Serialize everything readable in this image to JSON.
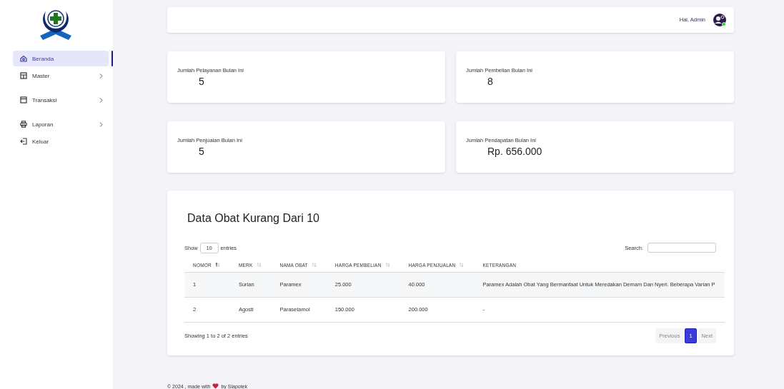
{
  "sidebar": {
    "items": [
      {
        "label": "Beranda",
        "selected": true,
        "has_submenu": false
      },
      {
        "label": "Master",
        "selected": false,
        "has_submenu": true
      },
      {
        "label": "Transaksi",
        "selected": false,
        "has_submenu": true
      },
      {
        "label": "Laporan",
        "selected": false,
        "has_submenu": true
      },
      {
        "label": "Keluar",
        "selected": false,
        "has_submenu": false
      }
    ]
  },
  "topbar": {
    "greeting": "Hai, Admin",
    "online": true
  },
  "stats": [
    {
      "label": "Jumlah Pelayanan Bulan Ini",
      "value": "5"
    },
    {
      "label": "Jumlah Pembelian Bulan Ini",
      "value": "8"
    },
    {
      "label": "Jumlah Penjualan Bulan Ini",
      "value": "5"
    },
    {
      "label": "Jumlah Pendapatan Bulan Ini",
      "value": "Rp. 656.000"
    }
  ],
  "table_card": {
    "title": "Data Obat Kurang Dari 10",
    "show_label": "Show",
    "page_size": "10",
    "entries_label": "entries",
    "search_label": "Search:",
    "columns": [
      {
        "label": "NOMOR",
        "sortable": true,
        "sorted": true
      },
      {
        "label": "MERK",
        "sortable": true,
        "sorted": false
      },
      {
        "label": "NAMA OBAT",
        "sortable": true,
        "sorted": false
      },
      {
        "label": "HARGA PEMBELIAN",
        "sortable": true,
        "sorted": false
      },
      {
        "label": "HARGA PENJUALAN",
        "sortable": true,
        "sorted": false
      },
      {
        "label": "KETERANGAN",
        "sortable": false
      }
    ],
    "rows": [
      [
        "1",
        "Surian",
        "Paramex",
        "25.000",
        "40.000",
        "Paramex Adalah Obat Yang Bermanfaat Untuk Meredakan Demam Dan Nyeri. Beberapa Varian P"
      ],
      [
        "2",
        "Agosti",
        "Parasetamol",
        "150.000",
        "200.000",
        "-"
      ]
    ],
    "info": "Showing 1 to 2 of 2 entries",
    "pagination": [
      {
        "label": "Previous",
        "selected": false
      },
      {
        "label": "1",
        "selected": true
      },
      {
        "label": "Next",
        "selected": false
      }
    ]
  },
  "footer": {
    "text": "© 2024 , made with",
    "heart": true,
    "suffix": "by Siapotek"
  }
}
